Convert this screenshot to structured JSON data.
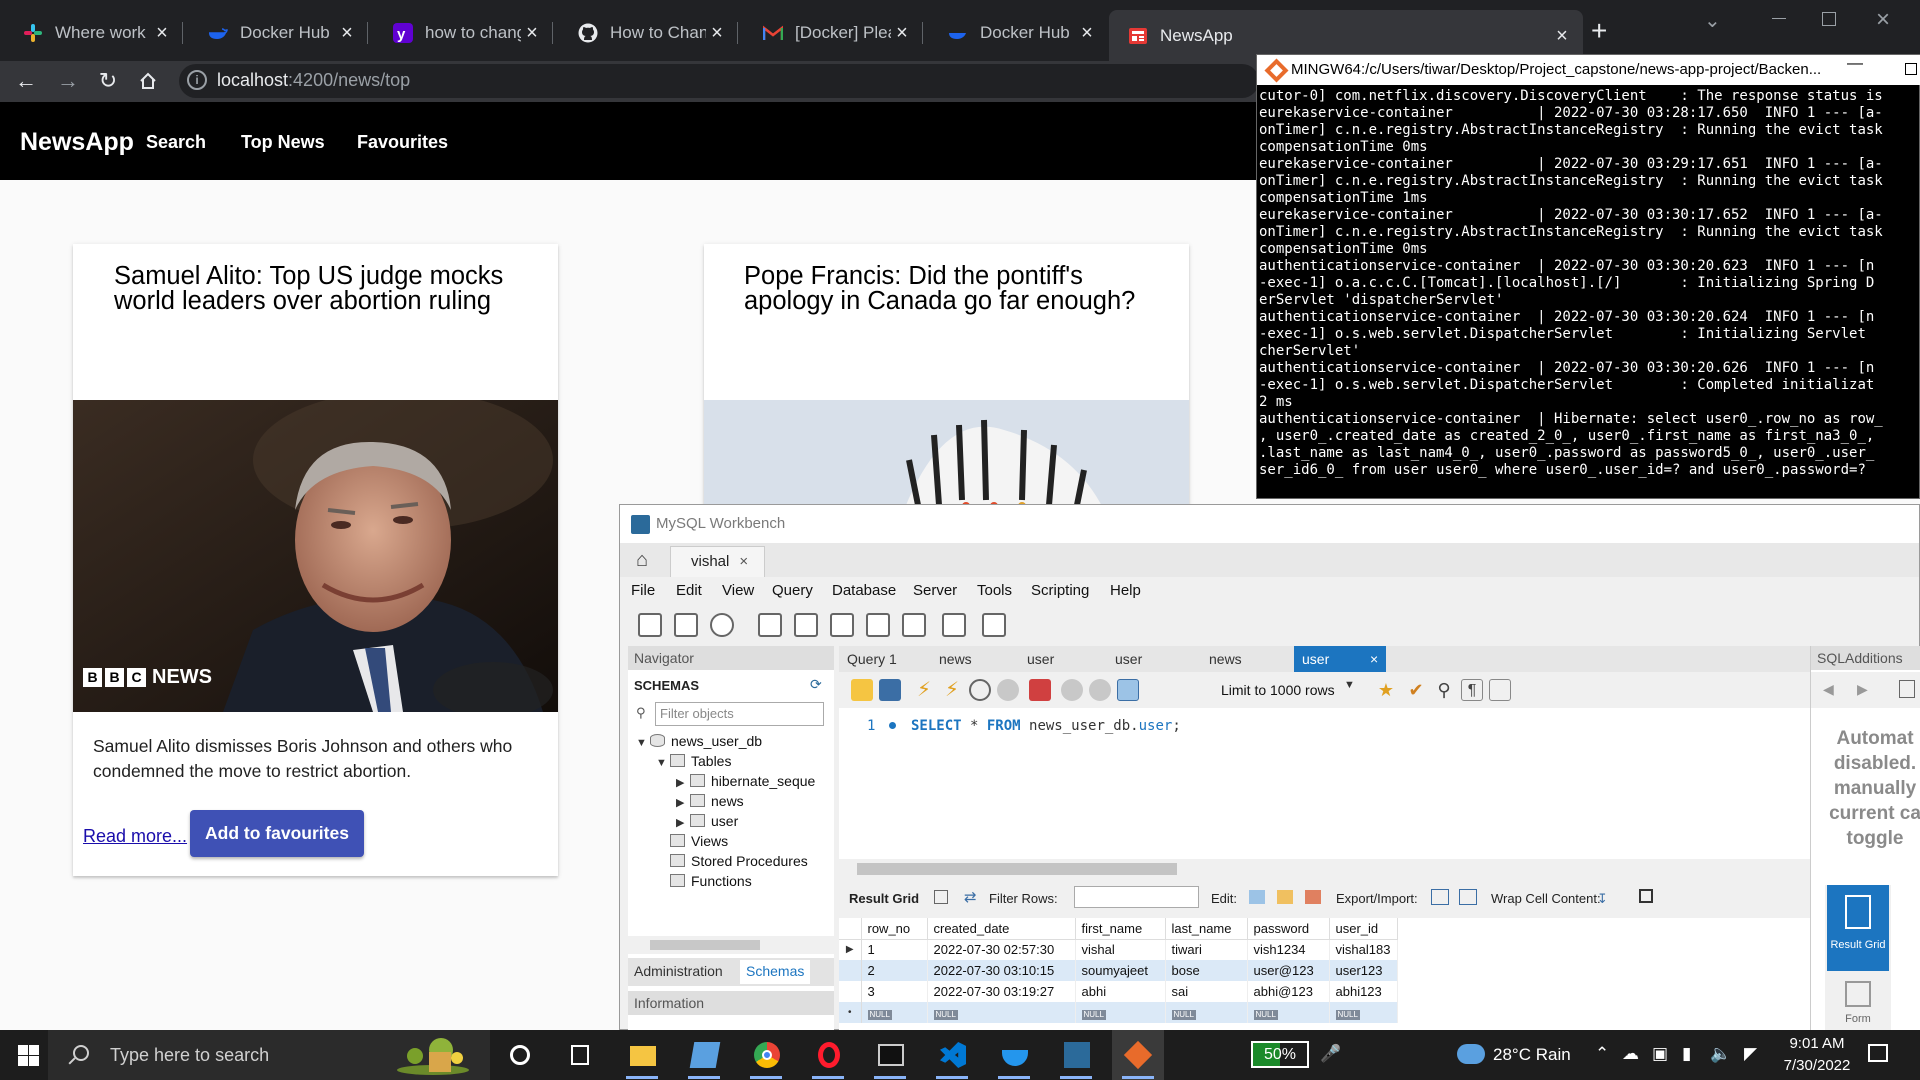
{
  "browser": {
    "tabs": [
      {
        "title": "Where work happens",
        "icon": "slack-icon",
        "active": false
      },
      {
        "title": "Docker Hub",
        "icon": "docker-icon",
        "active": false
      },
      {
        "title": "how to change docke",
        "icon": "yahoo-icon",
        "active": false
      },
      {
        "title": "How to Change my D",
        "icon": "github-icon",
        "active": false
      },
      {
        "title": "[Docker] Please confir",
        "icon": "gmail-icon",
        "active": false
      },
      {
        "title": "Docker Hub",
        "icon": "docker-icon",
        "active": false
      },
      {
        "title": "NewsApp",
        "icon": "newsapp-icon",
        "active": true
      }
    ],
    "new_tab": "+",
    "url_host": "localhost",
    "url_path": ":4200/news/top"
  },
  "newsapp": {
    "brand": "NewsApp",
    "nav": [
      "Search",
      "Top News",
      "Favourites"
    ],
    "cards": [
      {
        "title": "Samuel Alito: Top US judge mocks world leaders over abortion ruling",
        "image_watermark": "NEWS",
        "image_logo_letters": [
          "B",
          "B",
          "C"
        ],
        "description": "Samuel Alito dismisses Boris Johnson and others who condemned the move to restrict abortion.",
        "read_more": "Read more...",
        "favourite_button": "Add to favourites"
      },
      {
        "title": "Pope Francis: Did the pontiff's apology in Canada go far enough?"
      }
    ]
  },
  "terminal": {
    "title": "MINGW64:/c/Users/tiwar/Desktop/Project_capstone/news-app-project/Backen...",
    "lines": [
      "cutor-0] com.netflix.discovery.DiscoveryClient    : The response status is",
      "eurekaservice-container          | 2022-07-30 03:28:17.650  INFO 1 --- [a-",
      "onTimer] c.n.e.registry.AbstractInstanceRegistry  : Running the evict task",
      "compensationTime 0ms",
      "eurekaservice-container          | 2022-07-30 03:29:17.651  INFO 1 --- [a-",
      "onTimer] c.n.e.registry.AbstractInstanceRegistry  : Running the evict task",
      "compensationTime 1ms",
      "eurekaservice-container          | 2022-07-30 03:30:17.652  INFO 1 --- [a-",
      "onTimer] c.n.e.registry.AbstractInstanceRegistry  : Running the evict task",
      "compensationTime 0ms",
      "authenticationservice-container  | 2022-07-30 03:30:20.623  INFO 1 --- [n",
      "-exec-1] o.a.c.c.C.[Tomcat].[localhost].[/]       : Initializing Spring D",
      "erServlet 'dispatcherServlet'",
      "authenticationservice-container  | 2022-07-30 03:30:20.624  INFO 1 --- [n",
      "-exec-1] o.s.web.servlet.DispatcherServlet        : Initializing Servlet",
      "cherServlet'",
      "authenticationservice-container  | 2022-07-30 03:30:20.626  INFO 1 --- [n",
      "-exec-1] o.s.web.servlet.DispatcherServlet        : Completed initializat",
      "2 ms",
      "authenticationservice-container  | Hibernate: select user0_.row_no as row_",
      ", user0_.created_date as created_2_0_, user0_.first_name as first_na3_0_,",
      ".last_name as last_nam4_0_, user0_.password as password5_0_, user0_.user_",
      "ser_id6_0_ from user user0_ where user0_.user_id=? and user0_.password=?"
    ]
  },
  "workbench": {
    "title": "MySQL Workbench",
    "connection_tab": "vishal",
    "menu": [
      "File",
      "Edit",
      "View",
      "Query",
      "Database",
      "Server",
      "Tools",
      "Scripting",
      "Help"
    ],
    "navigator": {
      "header": "Navigator",
      "schemas_label": "SCHEMAS",
      "filter_placeholder": "Filter objects",
      "db": "news_user_db",
      "tables_label": "Tables",
      "tables": [
        "hibernate_seque",
        "news",
        "user"
      ],
      "views": "Views",
      "procedures": "Stored Procedures",
      "functions": "Functions",
      "tabs": [
        "Administration",
        "Schemas"
      ],
      "info_header": "Information"
    },
    "query_tabs": [
      "Query 1",
      "news",
      "user",
      "user",
      "news",
      "user"
    ],
    "limit_label": "Limit to 1000 rows",
    "sql": {
      "line": "1",
      "select": "SELECT",
      "star": " * ",
      "from": "FROM",
      "table": " news_user_db.",
      "tbl": "user",
      "end": ";"
    },
    "result_toolbar": {
      "result_grid": "Result Grid",
      "filter_rows": "Filter Rows:",
      "edit": "Edit:",
      "export_import": "Export/Import:",
      "wrap": "Wrap Cell Content:"
    },
    "grid": {
      "columns": [
        "row_no",
        "created_date",
        "first_name",
        "last_name",
        "password",
        "user_id"
      ],
      "rows": [
        [
          "1",
          "2022-07-30 02:57:30",
          "vishal",
          "tiwari",
          "vish1234",
          "vishal183"
        ],
        [
          "2",
          "2022-07-30 03:10:15",
          "soumyajeet",
          "bose",
          "user@123",
          "user123"
        ],
        [
          "3",
          "2022-07-30 03:19:27",
          "abhi",
          "sai",
          "abhi@123",
          "abhi123"
        ]
      ],
      "null_label": "NULL"
    },
    "side_tabs": {
      "result": "Result Grid",
      "form": "Form"
    },
    "sql_additions": {
      "header": "SQLAdditions",
      "text": [
        "Automat",
        "disabled.",
        "manually",
        "current ca",
        "toggle"
      ]
    }
  },
  "taskbar": {
    "search_placeholder": "Type here to search",
    "battery": "50%",
    "battery_level": 0.5,
    "weather": "28°C  Rain",
    "time": "9:01 AM",
    "date": "7/30/2022"
  },
  "colors": {
    "chrome_dark": "#202124",
    "newsapp_bar": "#000000",
    "favourite_button": "#3f51b5",
    "workbench_accent": "#1c75c0",
    "battery_fill": "#1b8a2a"
  }
}
